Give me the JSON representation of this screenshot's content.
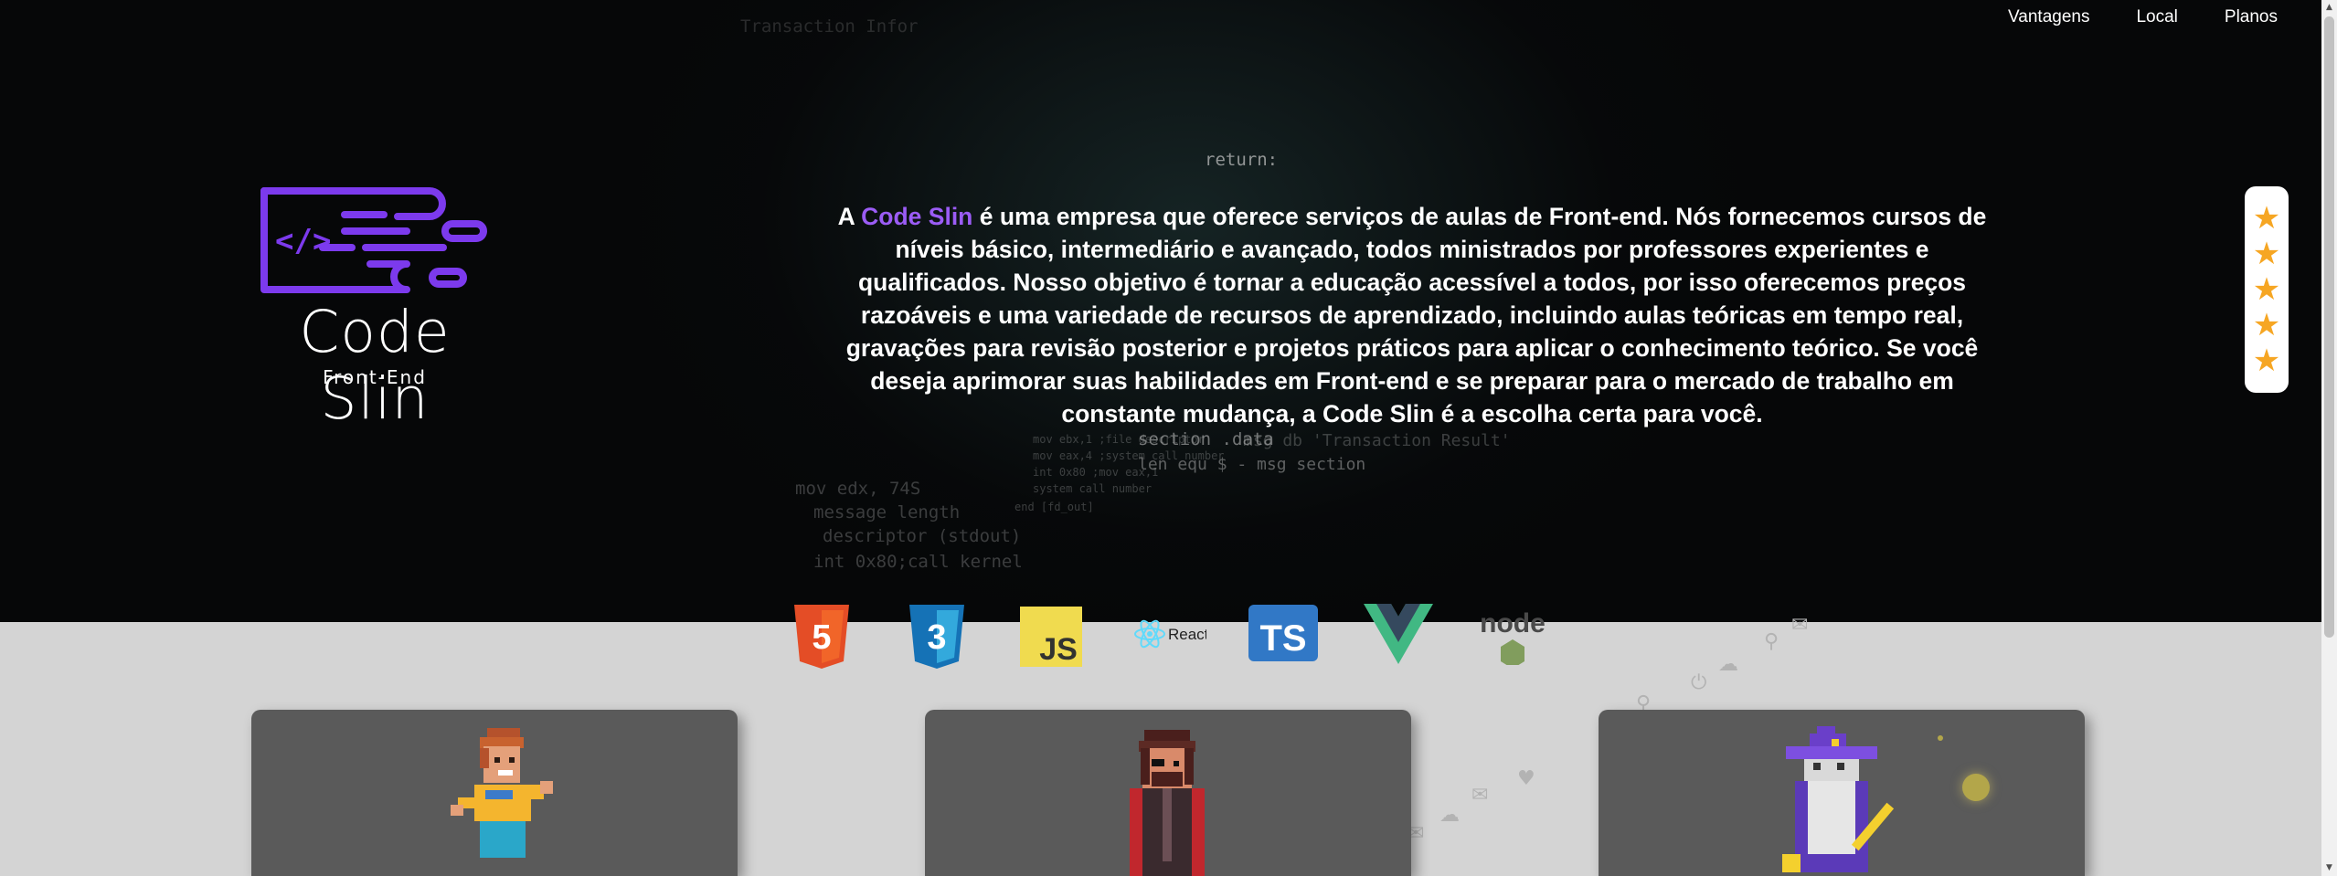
{
  "nav": {
    "items": [
      {
        "label": "Vantagens"
      },
      {
        "label": "Local"
      },
      {
        "label": "Planos"
      }
    ]
  },
  "logo": {
    "title": "Code Slin",
    "subtitle": "Front-End",
    "code_glyph": "</>",
    "accent_color": "#7c3aed"
  },
  "about": {
    "prefix": "A ",
    "brand": "Code Slin",
    "body": " é uma empresa que oferece serviços de aulas de Front-end. Nós fornecemos cursos de níveis básico, intermediário e avançado, todos ministrados por professores experientes e qualificados. Nosso objetivo é tornar a educação acessível a todos, por isso oferecemos preços razoáveis e uma variedade de recursos de aprendizado, incluindo aulas teóricas em tempo real, gravações para revisão posterior e projetos práticos para aplicar o conhecimento teórico. Se você deseja aprimorar suas habilidades em Front-end e se preparar para o mercado de trabalho em constante mudança, a Code Slin é a escolha certa para você."
  },
  "rating": {
    "stars": 5,
    "star_glyph": "★",
    "star_color": "#f6a623"
  },
  "background_code": [
    "return:",
    "section .data",
    "msg db 'Transaction Result'",
    "len equ $ - msg section",
    "mov ebx,1 ;file descriptor",
    "mov eax,4 ;system call number",
    "int 0x80 ;mov eax,1",
    "system call number",
    "end [fd_out]",
    "mov edx, 74S",
    "message length",
    "descriptor (stdout)",
    "int 0x80;call kernel",
    "Transaction Infor"
  ],
  "tech_icons": [
    {
      "name": "html5",
      "label": "5",
      "color": "#e44d26"
    },
    {
      "name": "css3",
      "label": "3",
      "color": "#1572b6"
    },
    {
      "name": "javascript",
      "label": "JS",
      "color": "#f0db4f"
    },
    {
      "name": "react",
      "label": "React",
      "color": "#61dafb"
    },
    {
      "name": "typescript",
      "label": "TS",
      "color": "#3178c6"
    },
    {
      "name": "vue",
      "label": "",
      "color": "#41b883"
    },
    {
      "name": "node",
      "label": "node",
      "color": "#6b8e3e"
    }
  ],
  "cards": [
    {
      "avatar": "pixel-boy"
    },
    {
      "avatar": "pixel-caped-man"
    },
    {
      "avatar": "pixel-wizard"
    }
  ],
  "colors": {
    "hero_bg": "#060708",
    "page_bg": "#d4d4d4",
    "card_bg": "#5a5a5a",
    "brand_purple": "#9b5cf5"
  }
}
